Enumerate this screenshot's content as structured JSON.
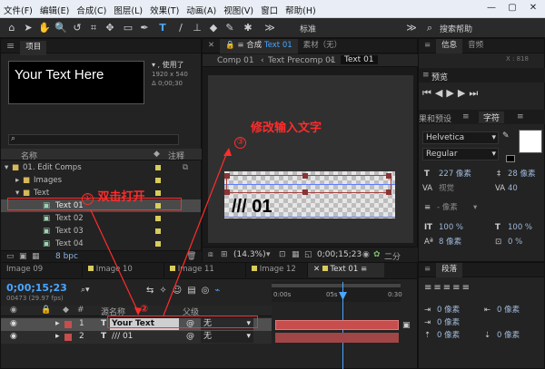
{
  "menu": [
    "文件(F)",
    "编辑(E)",
    "合成(C)",
    "图层(L)",
    "效果(T)",
    "动画(A)",
    "视图(V)",
    "窗口",
    "帮助(H)"
  ],
  "toolbar": {
    "workspace": "标准",
    "search": "搜索帮助"
  },
  "project": {
    "tab": "项目",
    "preview_text": "Your Text Here",
    "info_lines": [
      "▾ , 使用了",
      "1920 x 540",
      "Δ 0;00;30"
    ],
    "columns": {
      "name": "名称",
      "label": "注释"
    },
    "items": [
      {
        "name": "01. Edit Comps",
        "indent": 0,
        "kind": "folder"
      },
      {
        "name": "Images",
        "indent": 1,
        "kind": "folder"
      },
      {
        "name": "Text",
        "indent": 1,
        "kind": "folder"
      },
      {
        "name": "Text 01",
        "indent": 2,
        "kind": "comp",
        "selected": true
      },
      {
        "name": "Text 02",
        "indent": 2,
        "kind": "comp"
      },
      {
        "name": "Text 03",
        "indent": 2,
        "kind": "comp"
      },
      {
        "name": "Text 04",
        "indent": 2,
        "kind": "comp"
      }
    ],
    "bpc": "8 bpc"
  },
  "composition": {
    "tab_prefix": "合成",
    "tab_name": "Text 01",
    "material_tab": "素材（无）",
    "breadcrumbs": [
      "Comp 01",
      "Text Precomp 01",
      "Text 01"
    ],
    "big_text": "/// 01",
    "zoom": "(14.3%)",
    "timecode": "0;00;15;23",
    "last_label": "二分"
  },
  "right_panel": {
    "top_tabs": [
      "信息",
      "音频"
    ],
    "xy": "X : 818",
    "preview_tab": "预览",
    "effects_tab": "果和预设",
    "char_tab": "字符",
    "font": "Helvetica",
    "style": "Regular",
    "size": "227 像素",
    "leading": "28 像素",
    "kerning": "视觉",
    "tracking": "40",
    "stroke": "- 像素",
    "vscale": "100 %",
    "hscale": "100 %",
    "baseline": "8 像素",
    "tsume": "0 %",
    "para_tab": "段落",
    "para_vals": [
      "0 像素",
      "0 像素",
      "0 像素",
      "0 像素",
      "0 像素"
    ]
  },
  "timeline": {
    "tabs": [
      "Image 09",
      "Image 10",
      "Image 11",
      "Image 12",
      "Text 01"
    ],
    "timecode": "0;00;15;23",
    "fps": "00473 (29.97 fps)",
    "ruler": [
      "0:00s",
      "05s",
      "0:30"
    ],
    "columns": {
      "num": "#",
      "source": "源名称",
      "parent": "父级"
    },
    "layers": [
      {
        "num": "1",
        "name": "Your Text Here",
        "parent": "无",
        "selected": true
      },
      {
        "num": "2",
        "name": "/// 01",
        "parent": "无",
        "selected": false
      }
    ]
  },
  "annotations": {
    "step1": "双击打开",
    "step2": "②",
    "step3": "修改输入文字",
    "num1": "①",
    "num3": "③"
  },
  "colors": {
    "accent_blue": "#4aa6ff",
    "annotation_red": "#ff2c2c",
    "label_yellow": "#d9cc5a",
    "layer_red": "#c84d4d"
  }
}
